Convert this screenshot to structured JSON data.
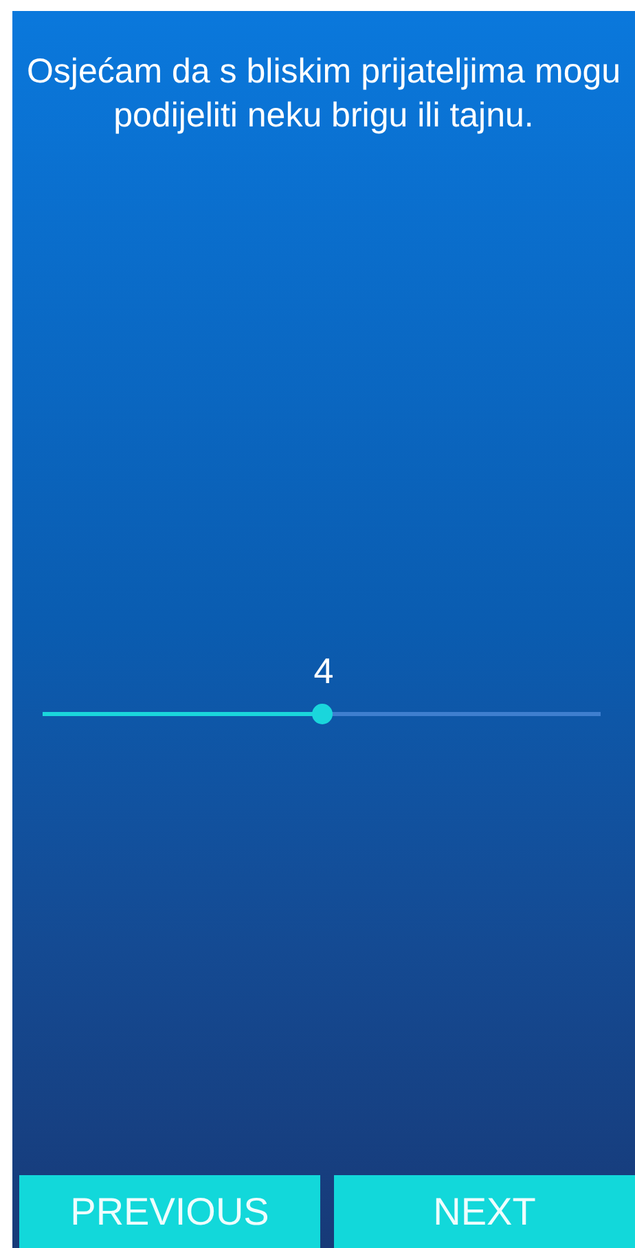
{
  "question": "Osjećam da s bliskim prijateljima mogu podijeliti neku brigu ili tajnu.",
  "slider": {
    "reading": "4",
    "level": 0.5
  },
  "buttons": [
    {
      "label": "PREVIOUS"
    },
    {
      "label": "NEXT"
    }
  ]
}
